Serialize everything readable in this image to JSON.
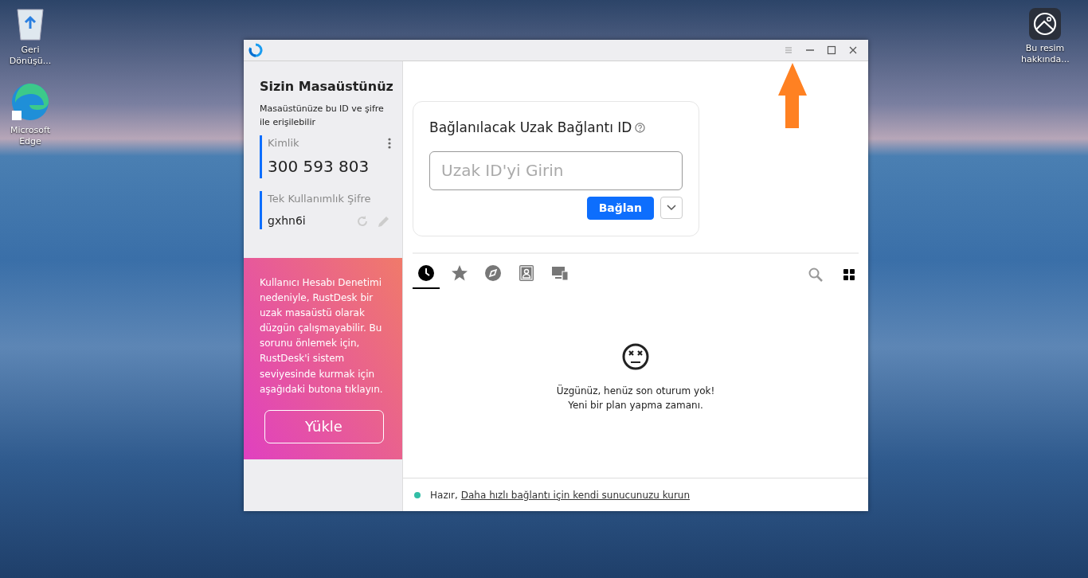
{
  "desktop_icons": [
    {
      "kind": "recycle-bin",
      "label": "Geri Dönüşü..."
    },
    {
      "kind": "edge",
      "label": "Microsoft Edge"
    },
    {
      "kind": "picture",
      "label": "Bu resim hakkında..."
    }
  ],
  "window": {
    "title_buttons": [
      {
        "kind": "menu"
      },
      {
        "kind": "minimize"
      },
      {
        "kind": "maximize"
      },
      {
        "kind": "close"
      }
    ]
  },
  "sidebar": {
    "title": "Sizin Masaüstünüz",
    "subtitle": "Masaüstünüze bu ID ve şifre ile erişilebilir",
    "id_label": "Kimlik",
    "id_value": "300 593 803",
    "password_label": "Tek Kullanımlık Şifre",
    "password_value": "gxhn6i"
  },
  "banner": {
    "text": "Kullanıcı Hesabı Denetimi nedeniyle, RustDesk bir uzak masaüstü olarak düzgün çalışmayabilir. Bu sorunu önlemek için, RustDesk'i sistem seviyesinde kurmak için aşağıdaki butona tıklayın.",
    "button": "Yükle"
  },
  "connect": {
    "title": "Bağlanılacak Uzak Bağlantı ID",
    "placeholder": "Uzak ID'yi Girin",
    "button": "Bağlan"
  },
  "tabs": [
    {
      "kind": "recent",
      "selected": true
    },
    {
      "kind": "favorites",
      "selected": false
    },
    {
      "kind": "discovered",
      "selected": false
    },
    {
      "kind": "address-book",
      "selected": false
    },
    {
      "kind": "devices",
      "selected": false
    }
  ],
  "empty": {
    "line1": "Üzgünüz, henüz son oturum yok!",
    "line2": "Yeni bir plan yapma zamanı."
  },
  "status_bar": {
    "color": "#32bea6",
    "status": "Hazır,",
    "link": "Daha hızlı bağlantı için kendi sunucunuzu kurun"
  }
}
